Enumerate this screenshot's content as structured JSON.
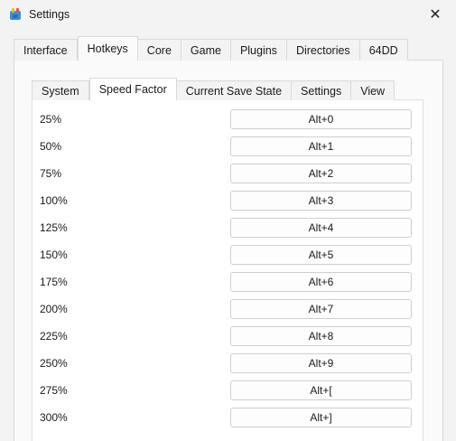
{
  "window": {
    "title": "Settings",
    "close_glyph": "✕",
    "icon": "mupen-app-icon"
  },
  "outer_tabs": [
    {
      "label": "Interface",
      "active": false
    },
    {
      "label": "Hotkeys",
      "active": true
    },
    {
      "label": "Core",
      "active": false
    },
    {
      "label": "Game",
      "active": false
    },
    {
      "label": "Plugins",
      "active": false
    },
    {
      "label": "Directories",
      "active": false
    },
    {
      "label": "64DD",
      "active": false
    }
  ],
  "inner_tabs": [
    {
      "label": "System",
      "active": false
    },
    {
      "label": "Speed Factor",
      "active": true
    },
    {
      "label": "Current Save State",
      "active": false
    },
    {
      "label": "Settings",
      "active": false
    },
    {
      "label": "View",
      "active": false
    }
  ],
  "hotkeys": [
    {
      "label": "25%",
      "key": "Alt+0"
    },
    {
      "label": "50%",
      "key": "Alt+1"
    },
    {
      "label": "75%",
      "key": "Alt+2"
    },
    {
      "label": "100%",
      "key": "Alt+3"
    },
    {
      "label": "125%",
      "key": "Alt+4"
    },
    {
      "label": "150%",
      "key": "Alt+5"
    },
    {
      "label": "175%",
      "key": "Alt+6"
    },
    {
      "label": "200%",
      "key": "Alt+7"
    },
    {
      "label": "225%",
      "key": "Alt+8"
    },
    {
      "label": "250%",
      "key": "Alt+9"
    },
    {
      "label": "275%",
      "key": "Alt+["
    },
    {
      "label": "300%",
      "key": "Alt+]"
    }
  ]
}
